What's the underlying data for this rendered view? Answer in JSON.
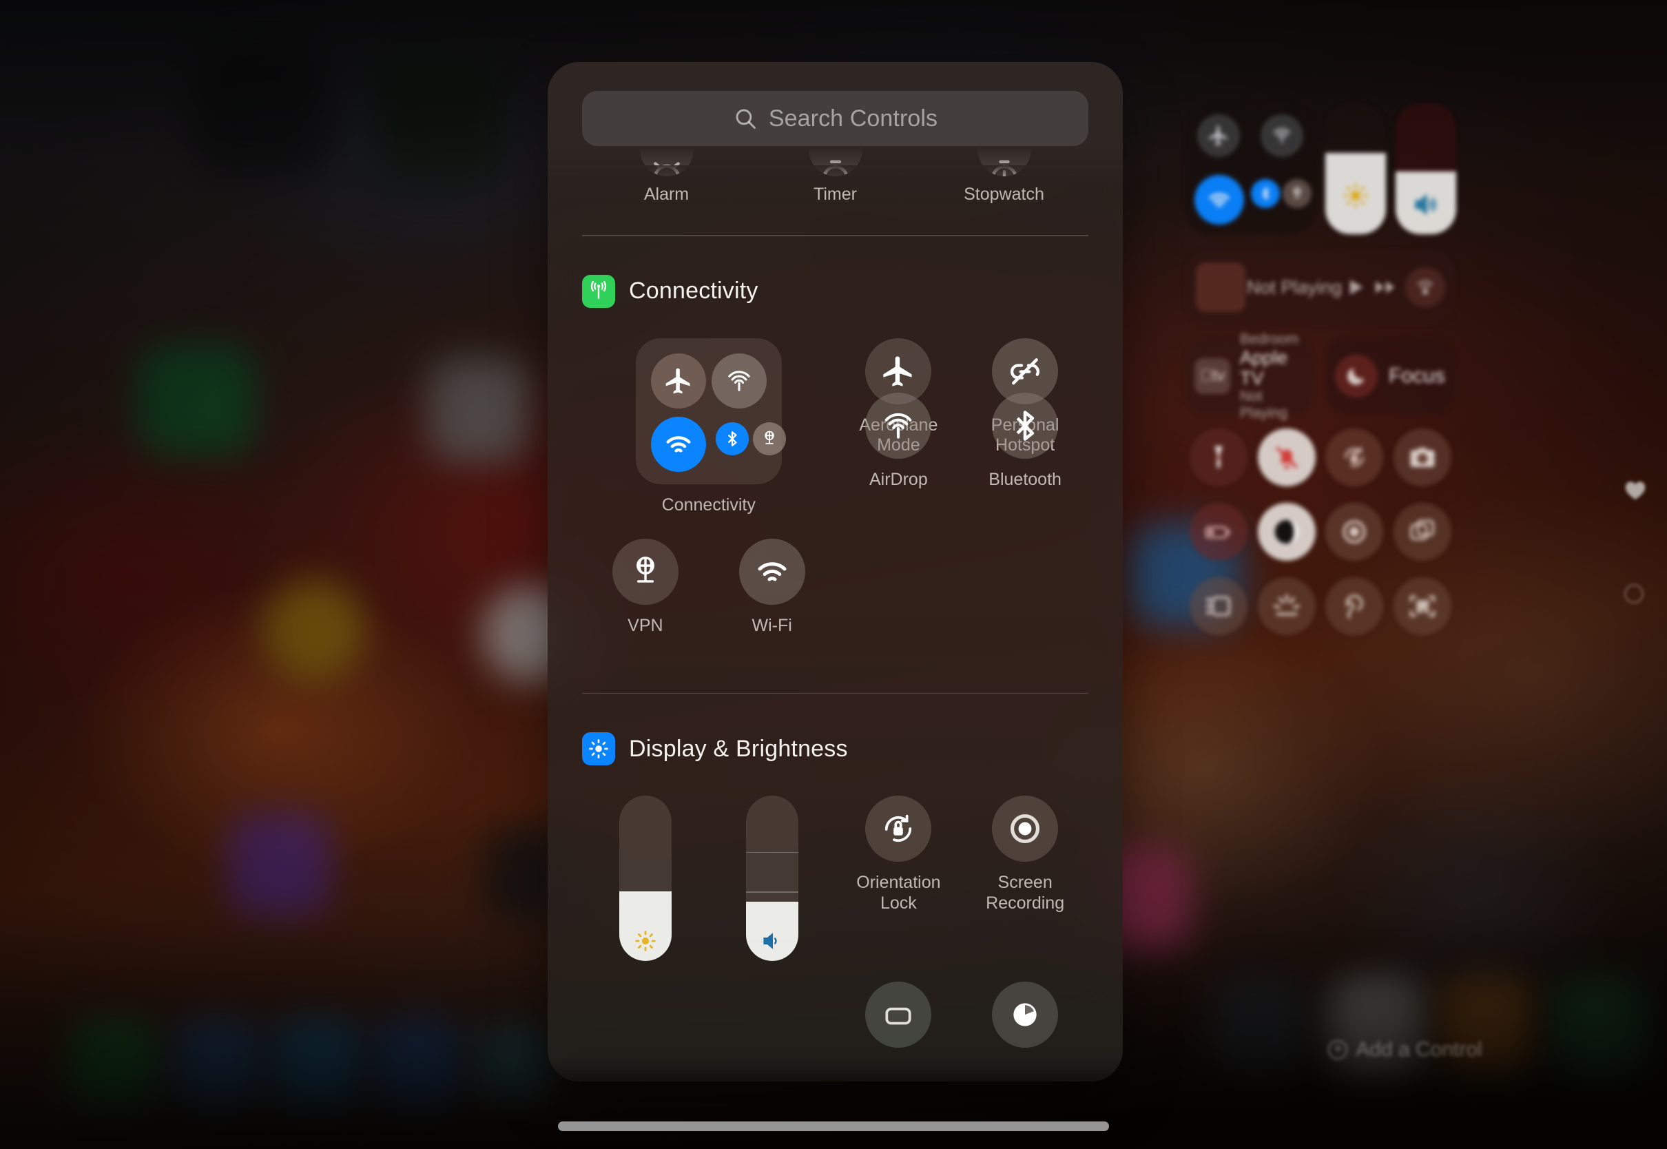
{
  "sheet": {
    "search": {
      "placeholder": "Search Controls",
      "icon": "search-icon"
    },
    "clipped_row": [
      {
        "label": "Alarm",
        "icon": "alarm-icon"
      },
      {
        "label": "Timer",
        "icon": "timer-icon"
      },
      {
        "label": "Stopwatch",
        "icon": "stopwatch-icon"
      }
    ],
    "sections": [
      {
        "title": "Connectivity",
        "icon": "connectivity-icon",
        "icon_color": "#30d158",
        "items": [
          {
            "label": "Connectivity",
            "icon": "connectivity-module",
            "type": "module"
          },
          {
            "label": "Aeroplane Mode",
            "icon": "airplane-icon",
            "state": "off"
          },
          {
            "label": "Personal Hotspot",
            "icon": "personal-hotspot-off-icon",
            "state": "off"
          },
          {
            "label": "VPN",
            "icon": "vpn-icon",
            "state": "off"
          },
          {
            "label": "Wi-Fi",
            "icon": "wifi-icon",
            "state": "off"
          },
          {
            "label": "AirDrop",
            "icon": "airdrop-icon",
            "state": "off"
          },
          {
            "label": "Bluetooth",
            "icon": "bluetooth-icon",
            "state": "off"
          }
        ],
        "module_sub_icons": [
          {
            "name": "airplane-icon",
            "state": "off"
          },
          {
            "name": "airdrop-icon",
            "state": "off"
          },
          {
            "name": "wifi-icon",
            "state": "on",
            "color": "#0a84ff"
          },
          {
            "name": "bluetooth-icon",
            "state": "on",
            "color": "#0a84ff"
          },
          {
            "name": "vpn-icon",
            "state": "off"
          }
        ]
      },
      {
        "title": "Display & Brightness",
        "icon": "brightness-icon",
        "icon_color": "#0a84ff",
        "items": [
          {
            "label": "Brightness",
            "icon": "brightness-slider",
            "type": "slider",
            "value": 42
          },
          {
            "label": "Volume",
            "icon": "volume-slider",
            "type": "slider",
            "value": 46
          },
          {
            "label": "Orientation Lock",
            "icon": "orientation-lock-icon",
            "state": "off"
          },
          {
            "label": "Screen Recording",
            "icon": "screen-recording-icon",
            "state": "off"
          }
        ]
      }
    ]
  },
  "control_center": {
    "connectivity_group": {
      "airplane": {
        "icon": "airplane-icon",
        "state": "off"
      },
      "airdrop": {
        "icon": "airdrop-icon",
        "state": "off"
      },
      "wifi": {
        "icon": "wifi-icon",
        "state": "on",
        "color": "#0a84ff"
      },
      "bluetooth": {
        "icon": "bluetooth-icon",
        "state": "on",
        "color": "#0a84ff"
      },
      "vpn": {
        "icon": "vpn-icon",
        "state": "off"
      }
    },
    "brightness_slider": {
      "icon": "sun-icon",
      "value": 62,
      "color": "#e6b422"
    },
    "volume_slider": {
      "icon": "speaker-icon",
      "value": 48,
      "color": "#2a7fa8"
    },
    "now_playing": {
      "title": "Not Playing",
      "play_icon": "play-icon",
      "next_icon": "fast-forward-icon",
      "airplay_icon": "airplay-icon"
    },
    "apple_tv": {
      "room": "Bedroom",
      "name": "Apple TV",
      "status": "Not Playing",
      "icon": "apple-tv-icon"
    },
    "focus": {
      "label": "Focus",
      "icon": "moon-icon"
    },
    "tiles": [
      {
        "icon": "flashlight-icon",
        "state": "off"
      },
      {
        "icon": "silent-mode-icon",
        "state": "on",
        "color": "#d8413c"
      },
      {
        "icon": "orientation-lock-icon",
        "state": "off"
      },
      {
        "icon": "camera-icon",
        "state": "off"
      },
      {
        "icon": "low-power-mode-icon",
        "state": "off"
      },
      {
        "icon": "dark-mode-icon",
        "state": "on"
      },
      {
        "icon": "screen-recording-icon",
        "state": "off"
      },
      {
        "icon": "stage-manager-icon",
        "state": "off"
      },
      {
        "icon": "sidebar-icon",
        "state": "off"
      },
      {
        "icon": "keyboard-brightness-icon",
        "state": "off"
      },
      {
        "icon": "hearing-icon",
        "state": "off"
      },
      {
        "icon": "qr-code-scanner-icon",
        "state": "off"
      }
    ],
    "add_control": {
      "label": "Add a Control",
      "icon": "plus-circle-icon"
    }
  },
  "edge_icons": [
    {
      "name": "heart-icon"
    },
    {
      "name": "circle-icon"
    }
  ],
  "home_indicator": {
    "name": "home-indicator"
  },
  "colors": {
    "accent_blue": "#0a84ff",
    "green": "#30d158",
    "red": "#d8413c",
    "sun_yellow": "#e6b422"
  }
}
